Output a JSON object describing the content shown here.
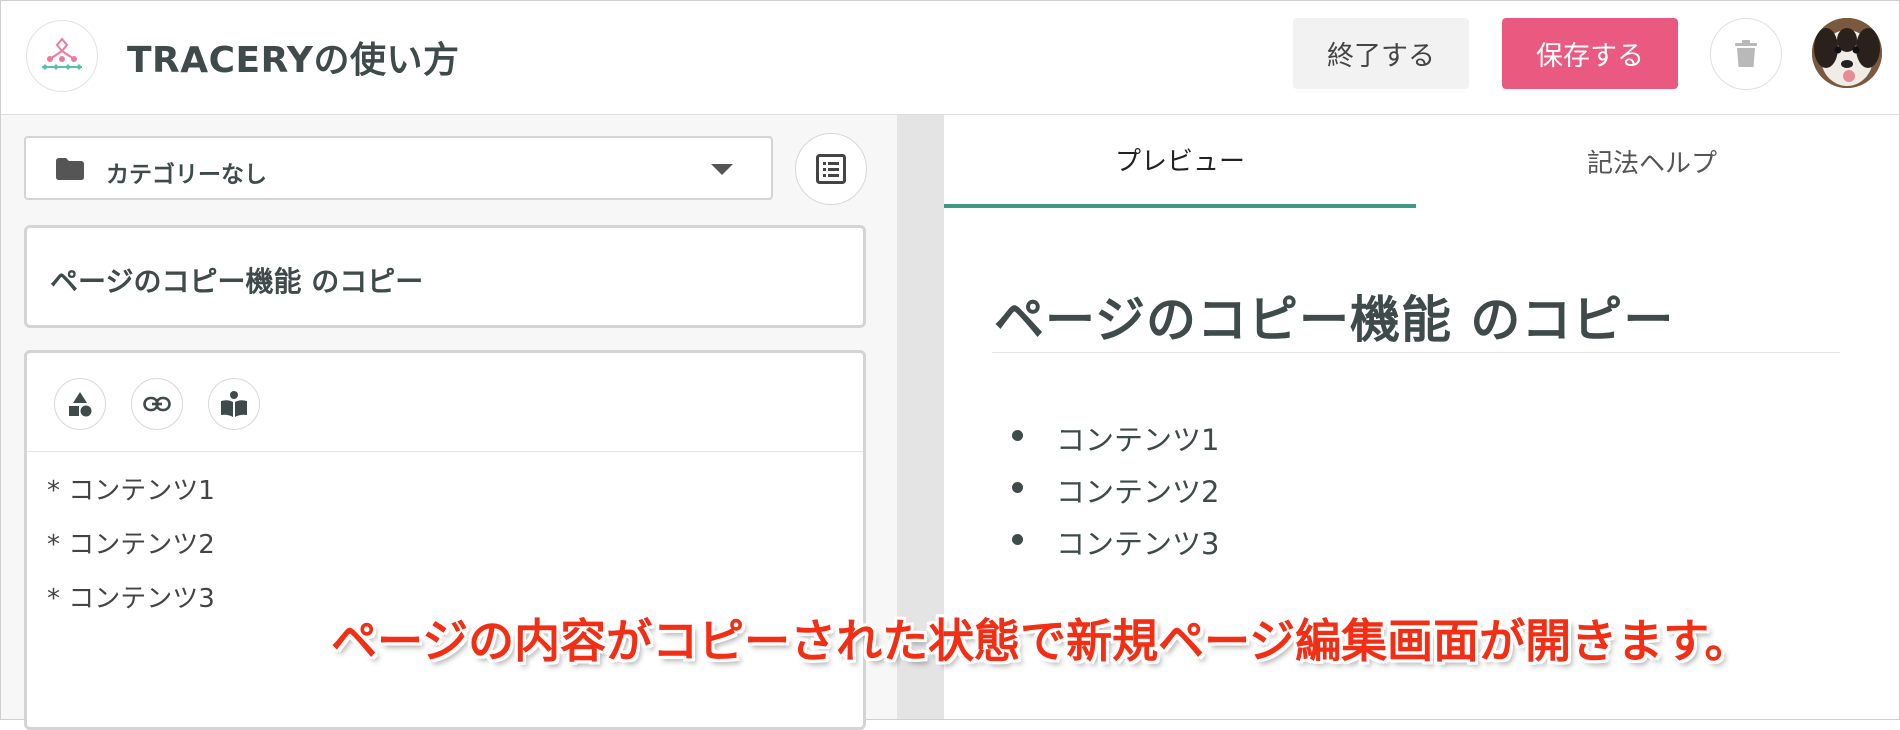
{
  "header": {
    "title": "TRACERYの使い方",
    "exit_label": "終了する",
    "save_label": "保存する"
  },
  "editor": {
    "category": "カテゴリーなし",
    "page_title": "ページのコピー機能 のコピー",
    "content_lines": [
      "* コンテンツ1",
      "* コンテンツ2",
      "* コンテンツ3"
    ]
  },
  "preview": {
    "tabs": [
      "プレビュー",
      "記法ヘルプ"
    ],
    "active_tab": "プレビュー",
    "heading": "ページのコピー機能 のコピー",
    "items": [
      "コンテンツ1",
      "コンテンツ2",
      "コンテンツ3"
    ]
  },
  "annotation": "ページの内容がコピーされた状態で新規ページ編集画面が開きます。",
  "colors": {
    "save_button": "#ea5a80",
    "tab_accent": "#3e9a86",
    "annotation_text": "#f22e14",
    "logo_pink": "#ec7a98",
    "logo_teal": "#5bbfb0"
  },
  "icons": [
    "logo-icon",
    "trash-icon",
    "folder-icon",
    "dropdown-caret-icon",
    "toc-icon",
    "shapes-icon",
    "link-icon",
    "book-icon"
  ]
}
